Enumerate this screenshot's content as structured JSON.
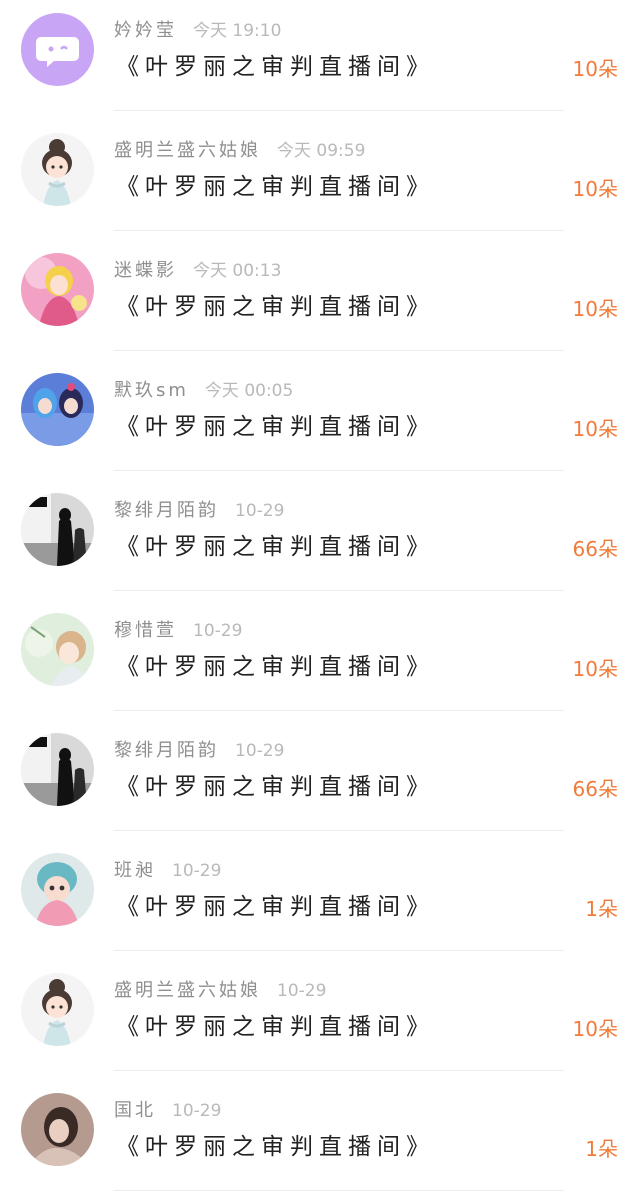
{
  "records": [
    {
      "name": "妗妗莹",
      "time": "今天  19:10",
      "room": "《叶罗丽之审判直播间》",
      "count": "10朵",
      "avatar_icon": "chat-bubble-avatar-icon",
      "avatar_colors": [
        "#c8a6f5",
        "#ffffff"
      ]
    },
    {
      "name": "盛明兰盛六姑娘",
      "time": "今天  09:59",
      "room": "《叶罗丽之审判直播间》",
      "count": "10朵",
      "avatar_icon": "cartoon-girl-avatar-icon",
      "avatar_colors": [
        "#f4f4f4",
        "#4a3b35"
      ]
    },
    {
      "name": "迷蝶影",
      "time": "今天  00:13",
      "room": "《叶罗丽之审判直播间》",
      "count": "10朵",
      "avatar_icon": "fairy-doll-avatar-icon",
      "avatar_colors": [
        "#f2a0c4",
        "#e05a8a"
      ]
    },
    {
      "name": "默玖sm",
      "time": "今天  00:05",
      "room": "《叶罗丽之审判直播间》",
      "count": "10朵",
      "avatar_icon": "doll-pair-avatar-icon",
      "avatar_colors": [
        "#5b7fd8",
        "#2a2a5a"
      ]
    },
    {
      "name": "黎绯月陌韵",
      "time": "10-29",
      "room": "《叶罗丽之审判直播间》",
      "count": "66朵",
      "avatar_icon": "silhouette-avatar-icon",
      "avatar_colors": [
        "#d9d9d9",
        "#111111"
      ]
    },
    {
      "name": "穆惜萱",
      "time": "10-29",
      "room": "《叶罗丽之审判直播间》",
      "count": "10朵",
      "avatar_icon": "anime-boy-avatar-icon",
      "avatar_colors": [
        "#dfeedd",
        "#d9b48c"
      ]
    },
    {
      "name": "黎绯月陌韵",
      "time": "10-29",
      "room": "《叶罗丽之审判直播间》",
      "count": "66朵",
      "avatar_icon": "silhouette-avatar-icon",
      "avatar_colors": [
        "#d9d9d9",
        "#111111"
      ]
    },
    {
      "name": "班昶",
      "time": "10-29",
      "room": "《叶罗丽之审判直播间》",
      "count": "1朵",
      "avatar_icon": "doll-child-avatar-icon",
      "avatar_colors": [
        "#68b9c4",
        "#f29bb5"
      ]
    },
    {
      "name": "盛明兰盛六姑娘",
      "time": "10-29",
      "room": "《叶罗丽之审判直播间》",
      "count": "10朵",
      "avatar_icon": "cartoon-girl-avatar-icon",
      "avatar_colors": [
        "#f4f4f4",
        "#4a3b35"
      ]
    },
    {
      "name": "国北",
      "time": "10-29",
      "room": "《叶罗丽之审判直播间》",
      "count": "1朵",
      "avatar_icon": "photo-portrait-avatar-icon",
      "avatar_colors": [
        "#b59a90",
        "#3a2a25"
      ]
    }
  ]
}
